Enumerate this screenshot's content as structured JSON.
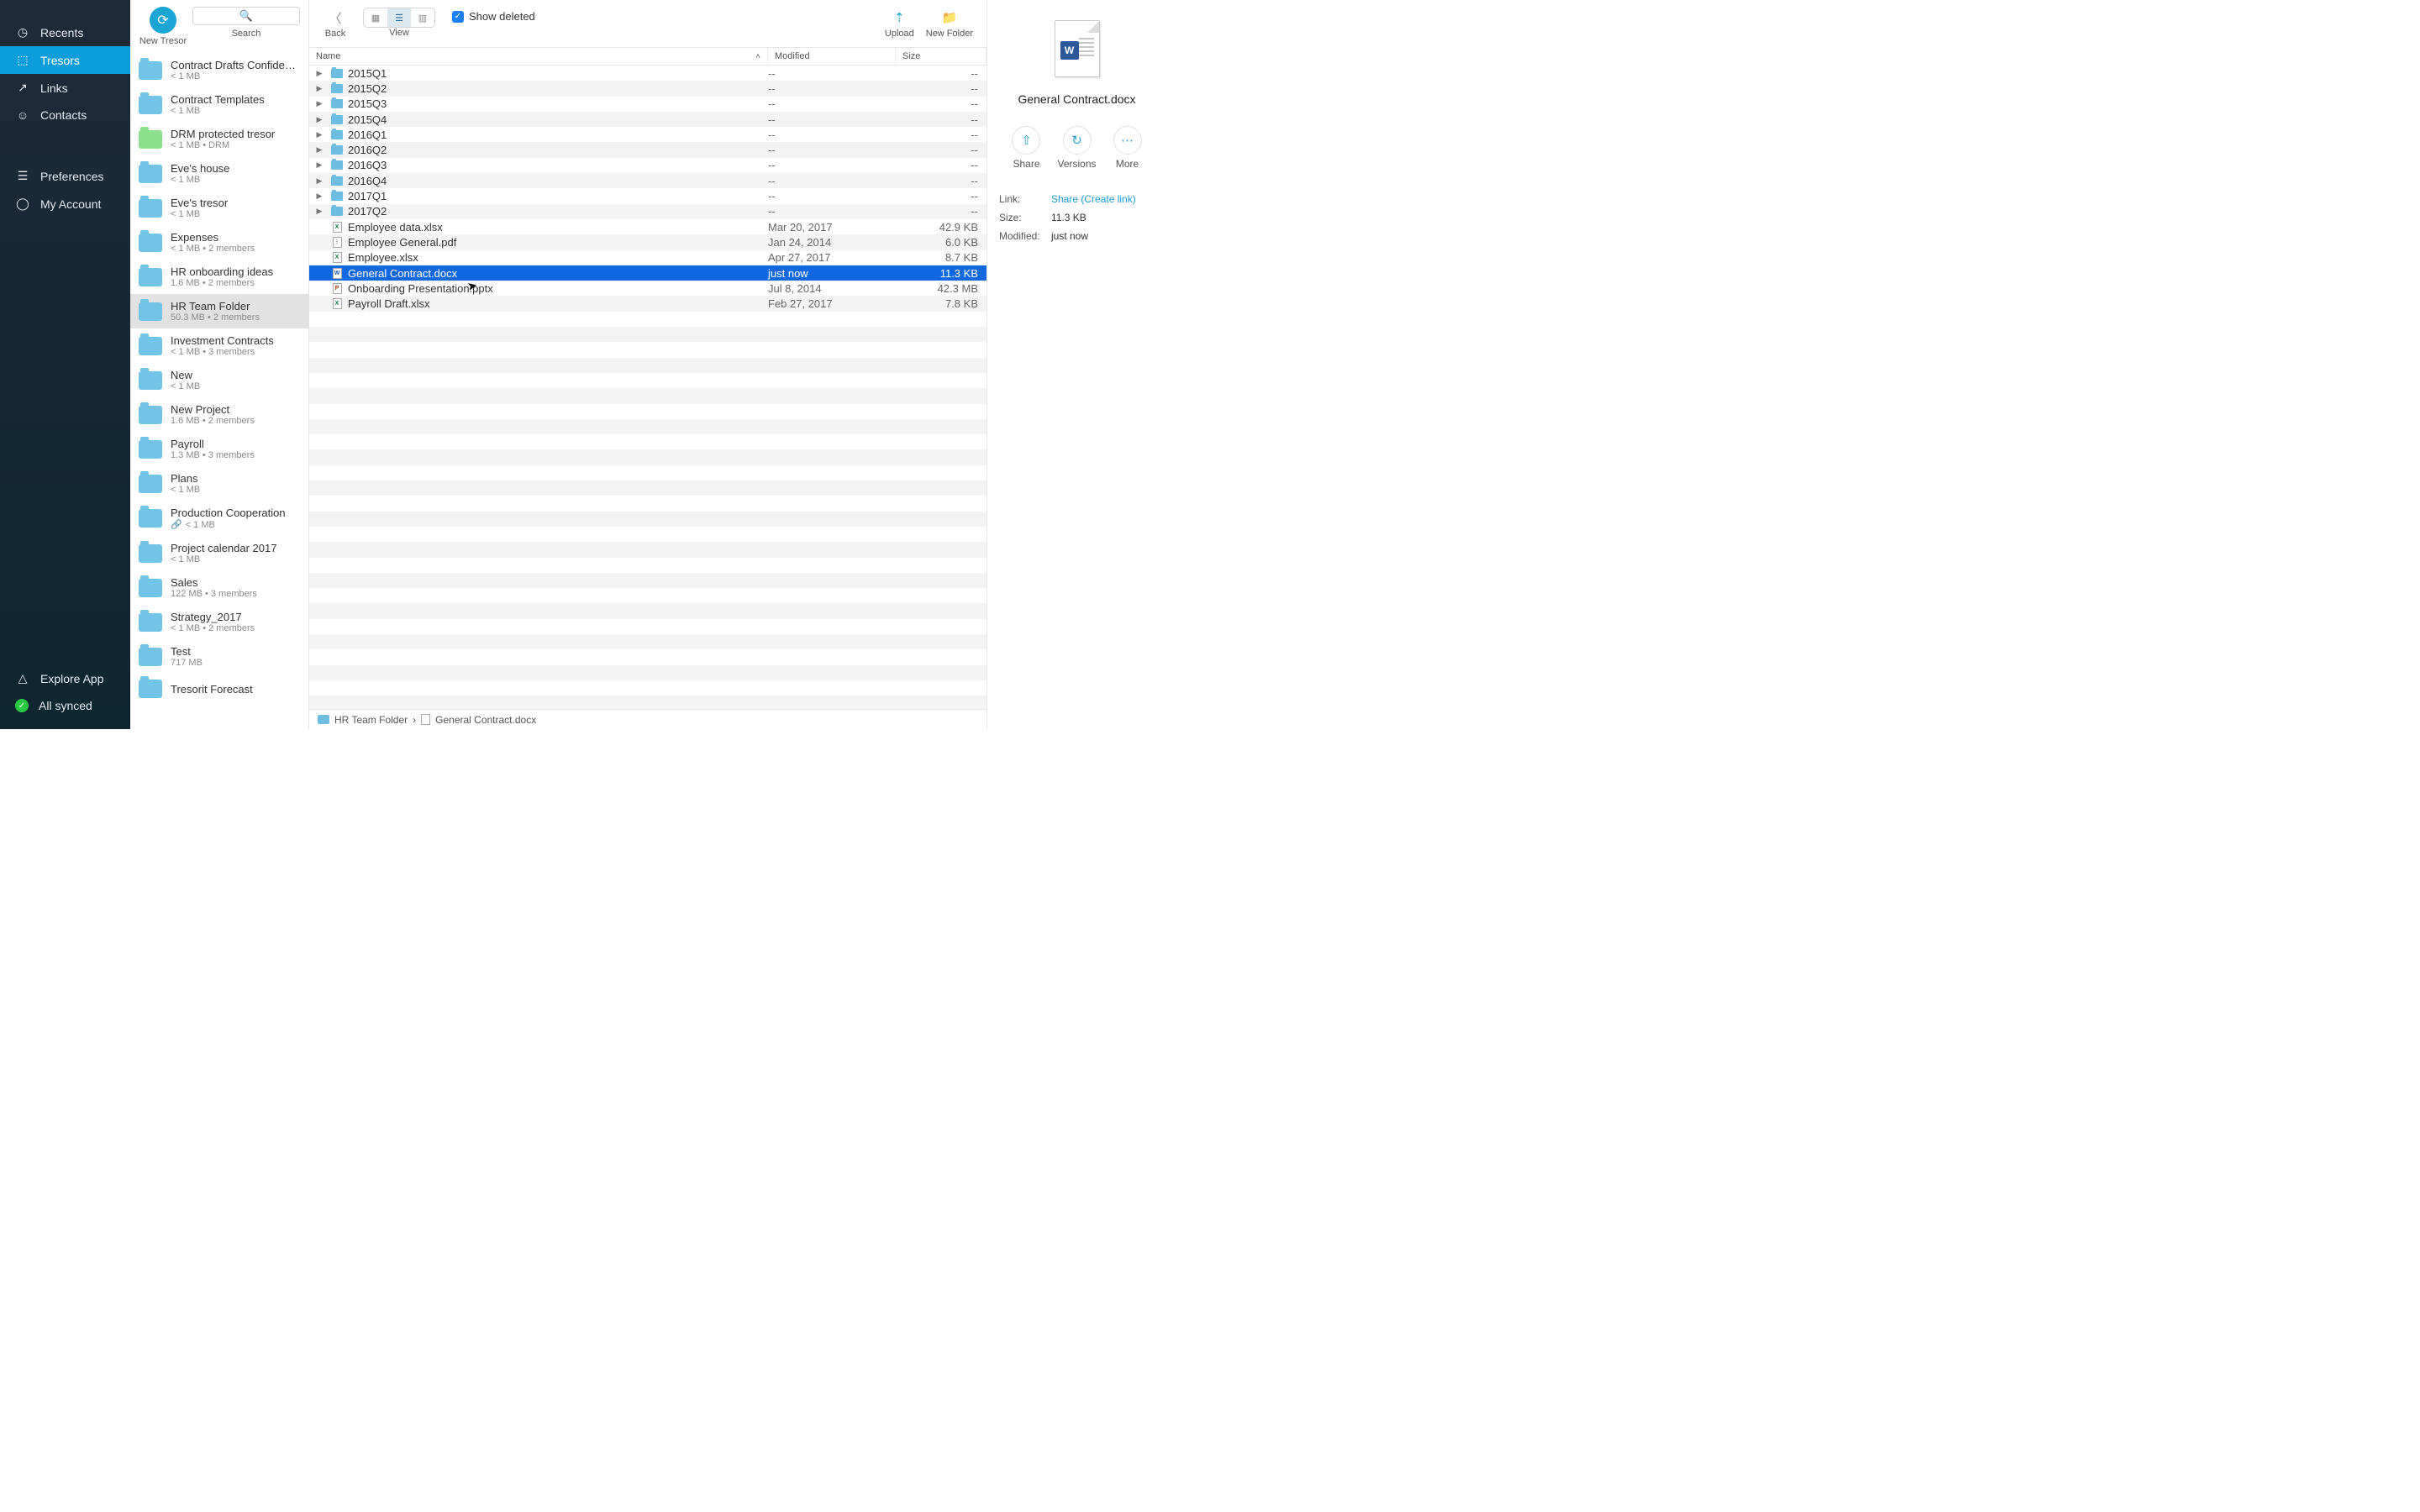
{
  "sidebar": {
    "items": [
      {
        "id": "recents",
        "label": "Recents",
        "glyph": "◷"
      },
      {
        "id": "tresors",
        "label": "Tresors",
        "glyph": "⬚",
        "selected": true
      },
      {
        "id": "links",
        "label": "Links",
        "glyph": "↗"
      },
      {
        "id": "contacts",
        "label": "Contacts",
        "glyph": "☺"
      }
    ],
    "secondary": [
      {
        "id": "preferences",
        "label": "Preferences",
        "glyph": "☰"
      },
      {
        "id": "account",
        "label": "My Account",
        "glyph": "◯"
      }
    ],
    "footer": [
      {
        "id": "explore",
        "label": "Explore App",
        "glyph": "△"
      },
      {
        "id": "synced",
        "label": "All synced",
        "glyph": "✓",
        "dot": true
      }
    ]
  },
  "tresorbar": {
    "new_label": "New Tresor",
    "search_label": "Search"
  },
  "tresors": [
    {
      "name": "Contract Drafts Confide…",
      "meta": "< 1 MB"
    },
    {
      "name": "Contract Templates",
      "meta": "< 1 MB"
    },
    {
      "name": "DRM protected tresor",
      "meta": "< 1 MB • DRM",
      "green": true
    },
    {
      "name": "Eve's house",
      "meta": "< 1 MB"
    },
    {
      "name": "Eve's tresor",
      "meta": "< 1 MB"
    },
    {
      "name": "Expenses",
      "meta": "< 1 MB • 2 members"
    },
    {
      "name": "HR onboarding ideas",
      "meta": "1.6 MB • 2 members"
    },
    {
      "name": "HR Team Folder",
      "meta": "50.3 MB • 2 members",
      "active": true
    },
    {
      "name": "Investment Contracts",
      "meta": "< 1 MB • 3 members"
    },
    {
      "name": "New",
      "meta": "< 1 MB"
    },
    {
      "name": "New Project",
      "meta": "1.6 MB • 2 members"
    },
    {
      "name": "Payroll",
      "meta": "1.3 MB • 3 members"
    },
    {
      "name": "Plans",
      "meta": "< 1 MB"
    },
    {
      "name": "Production Cooperation",
      "meta": "< 1 MB",
      "linked": true
    },
    {
      "name": "Project calendar 2017",
      "meta": "< 1 MB"
    },
    {
      "name": "Sales",
      "meta": "122 MB • 3 members"
    },
    {
      "name": "Strategy_2017",
      "meta": "< 1 MB • 2 members"
    },
    {
      "name": "Test",
      "meta": "717 MB"
    },
    {
      "name": "Tresorit Forecast",
      "meta": ""
    }
  ],
  "toolbar": {
    "back_label": "Back",
    "view_label": "View",
    "show_deleted": "Show deleted",
    "upload_label": "Upload",
    "new_folder_label": "New Folder"
  },
  "columns": {
    "name": "Name",
    "modified": "Modified",
    "size": "Size"
  },
  "rows": [
    {
      "type": "folder",
      "name": "2015Q1",
      "modified": "--",
      "size": "--"
    },
    {
      "type": "folder",
      "name": "2015Q2",
      "modified": "--",
      "size": "--"
    },
    {
      "type": "folder",
      "name": "2015Q3",
      "modified": "--",
      "size": "--"
    },
    {
      "type": "folder",
      "name": "2015Q4",
      "modified": "--",
      "size": "--"
    },
    {
      "type": "folder",
      "name": "2016Q1",
      "modified": "--",
      "size": "--"
    },
    {
      "type": "folder",
      "name": "2016Q2",
      "modified": "--",
      "size": "--"
    },
    {
      "type": "folder",
      "name": "2016Q3",
      "modified": "--",
      "size": "--"
    },
    {
      "type": "folder",
      "name": "2016Q4",
      "modified": "--",
      "size": "--"
    },
    {
      "type": "folder",
      "name": "2017Q1",
      "modified": "--",
      "size": "--"
    },
    {
      "type": "folder",
      "name": "2017Q2",
      "modified": "--",
      "size": "--"
    },
    {
      "type": "xlsx",
      "name": "Employee data.xlsx",
      "modified": "Mar 20, 2017",
      "size": "42.9 KB"
    },
    {
      "type": "pdf",
      "name": "Employee General.pdf",
      "modified": "Jan 24, 2014",
      "size": "6.0 KB"
    },
    {
      "type": "xlsx",
      "name": "Employee.xlsx",
      "modified": "Apr 27, 2017",
      "size": "8.7 KB"
    },
    {
      "type": "docx",
      "name": "General Contract.docx",
      "modified": "just now",
      "size": "11.3 KB",
      "selected": true
    },
    {
      "type": "pptx",
      "name": "Onboarding Presentation.pptx",
      "modified": "Jul 8, 2014",
      "size": "42.3 MB"
    },
    {
      "type": "xlsx",
      "name": "Payroll Draft.xlsx",
      "modified": "Feb 27, 2017",
      "size": "7.8 KB"
    }
  ],
  "breadcrumb": {
    "folder": "HR Team Folder",
    "file": "General Contract.docx"
  },
  "detail": {
    "filename": "General Contract.docx",
    "actions": {
      "share": "Share",
      "versions": "Versions",
      "more": "More"
    },
    "meta": {
      "link_label": "Link:",
      "link_value": "Share (Create link)",
      "size_label": "Size:",
      "size_value": "11.3 KB",
      "modified_label": "Modified:",
      "modified_value": "just now"
    }
  }
}
